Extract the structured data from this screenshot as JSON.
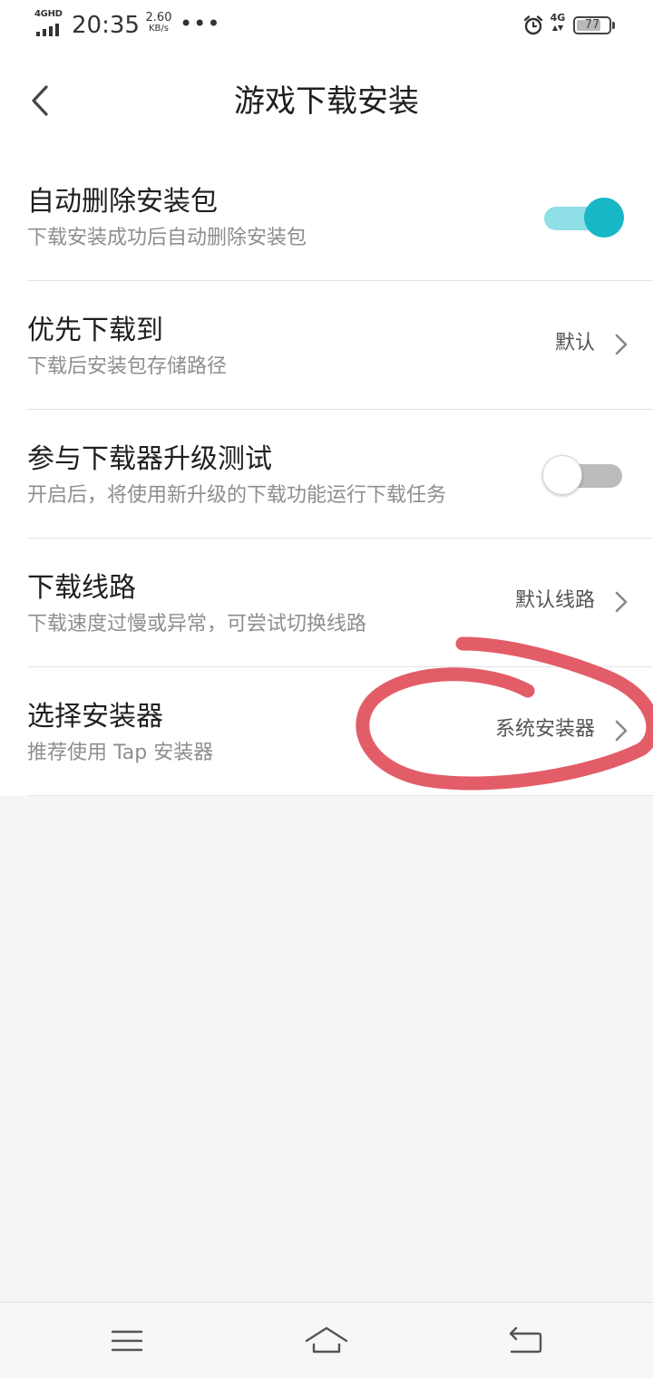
{
  "status_bar": {
    "network_tag": "4GHD",
    "time": "20:35",
    "speed_value": "2.60",
    "speed_unit": "KB/s",
    "more": "•••",
    "mobile_tag": "4G",
    "battery": "77",
    "battery_level_percent": 77
  },
  "header": {
    "title": "游戏下载安装"
  },
  "settings": [
    {
      "title": "自动删除安装包",
      "subtitle": "下载安装成功后自动删除安装包",
      "control": "toggle",
      "enabled": true
    },
    {
      "title": "优先下载到",
      "subtitle": "下载后安装包存储路径",
      "control": "link",
      "value": "默认"
    },
    {
      "title": "参与下载器升级测试",
      "subtitle": "开启后，将使用新升级的下载功能运行下载任务",
      "control": "toggle",
      "enabled": false
    },
    {
      "title": "下载线路",
      "subtitle": "下载速度过慢或异常，可尝试切换线路",
      "control": "link",
      "value": "默认线路"
    },
    {
      "title": "选择安装器",
      "subtitle": "推荐使用 Tap 安装器",
      "control": "link",
      "value": "系统安装器"
    }
  ],
  "colors": {
    "accent": "#17b7c6",
    "accent_track": "#8fdfe6",
    "annotation": "#e05460",
    "background": "#f4f5f7"
  },
  "icons": {
    "back": "chevron-left-icon",
    "nav_menu": "menu-icon",
    "nav_home": "home-icon",
    "nav_back": "return-icon"
  }
}
